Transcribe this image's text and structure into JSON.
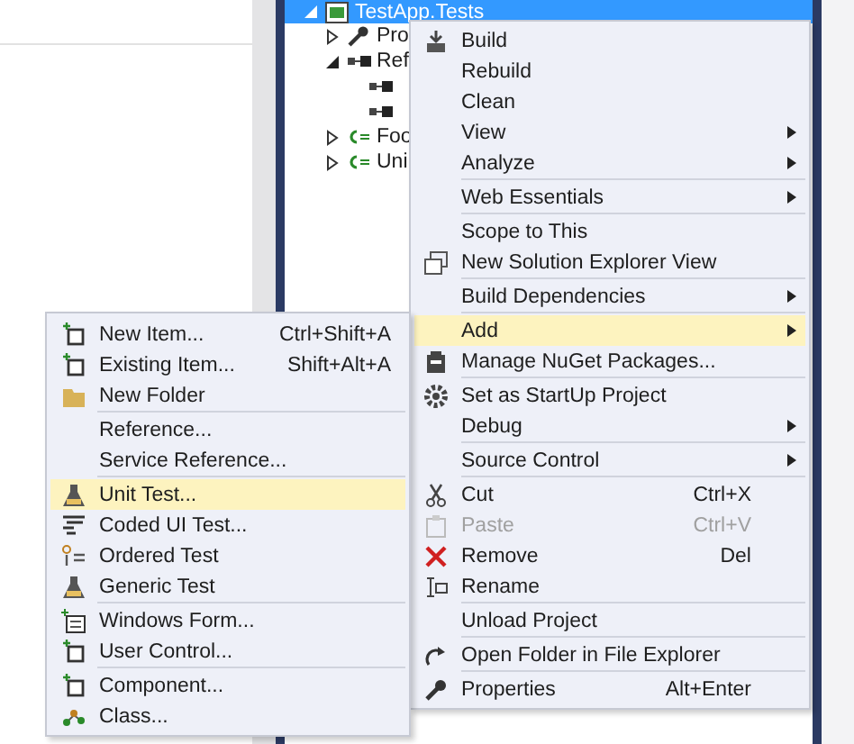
{
  "solution_explorer": {
    "tree": [
      {
        "label": "TestApp.Tests",
        "kind": "project",
        "expanded": true,
        "selected": true,
        "children": [
          {
            "label": "Pro",
            "kind": "properties",
            "expanded": false,
            "selected": false
          },
          {
            "label": "Ref",
            "kind": "references",
            "expanded": true,
            "selected": false,
            "children": [
              {
                "kind": "reference",
                "selected": false
              },
              {
                "kind": "reference",
                "selected": false
              }
            ]
          },
          {
            "label": "Foo",
            "kind": "csharp",
            "expanded": false,
            "selected": false
          },
          {
            "label": "Uni",
            "kind": "csharp",
            "expanded": false,
            "selected": false
          }
        ]
      }
    ]
  },
  "context_menu": {
    "items": [
      {
        "label": "Build",
        "submenu": false,
        "separator_before": false,
        "highlighted": false,
        "disabled": false
      },
      {
        "label": "Rebuild",
        "submenu": false,
        "separator_before": false,
        "highlighted": false,
        "disabled": false
      },
      {
        "label": "Clean",
        "submenu": false,
        "separator_before": false,
        "highlighted": false,
        "disabled": false
      },
      {
        "label": "View",
        "submenu": true,
        "separator_before": false,
        "highlighted": false,
        "disabled": false
      },
      {
        "label": "Analyze",
        "submenu": true,
        "separator_before": false,
        "highlighted": false,
        "disabled": false
      },
      {
        "label": "Web Essentials",
        "submenu": true,
        "separator_before": true,
        "highlighted": false,
        "disabled": false
      },
      {
        "label": "Scope to This",
        "submenu": false,
        "separator_before": true,
        "highlighted": false,
        "disabled": false
      },
      {
        "label": "New Solution Explorer View",
        "submenu": false,
        "separator_before": false,
        "highlighted": false,
        "disabled": false
      },
      {
        "label": "Build Dependencies",
        "submenu": true,
        "separator_before": true,
        "highlighted": false,
        "disabled": false
      },
      {
        "label": "Add",
        "submenu": true,
        "separator_before": true,
        "highlighted": true,
        "disabled": false
      },
      {
        "label": "Manage NuGet Packages...",
        "submenu": false,
        "separator_before": false,
        "highlighted": false,
        "disabled": false
      },
      {
        "label": "Set as StartUp Project",
        "submenu": false,
        "separator_before": true,
        "highlighted": false,
        "disabled": false
      },
      {
        "label": "Debug",
        "submenu": true,
        "separator_before": false,
        "highlighted": false,
        "disabled": false
      },
      {
        "label": "Source Control",
        "submenu": true,
        "separator_before": true,
        "highlighted": false,
        "disabled": false
      },
      {
        "label": "Cut",
        "shortcut": "Ctrl+X",
        "submenu": false,
        "separator_before": true,
        "highlighted": false,
        "disabled": false
      },
      {
        "label": "Paste",
        "shortcut": "Ctrl+V",
        "submenu": false,
        "separator_before": false,
        "highlighted": false,
        "disabled": true
      },
      {
        "label": "Remove",
        "shortcut": "Del",
        "submenu": false,
        "separator_before": false,
        "highlighted": false,
        "disabled": false
      },
      {
        "label": "Rename",
        "submenu": false,
        "separator_before": false,
        "highlighted": false,
        "disabled": false
      },
      {
        "label": "Unload Project",
        "submenu": false,
        "separator_before": true,
        "highlighted": false,
        "disabled": false
      },
      {
        "label": "Open Folder in File Explorer",
        "submenu": false,
        "separator_before": true,
        "highlighted": false,
        "disabled": false
      },
      {
        "label": "Properties",
        "shortcut": "Alt+Enter",
        "submenu": false,
        "separator_before": true,
        "highlighted": false,
        "disabled": false
      }
    ]
  },
  "add_submenu": {
    "items": [
      {
        "label": "New Item...",
        "shortcut": "Ctrl+Shift+A",
        "submenu": false,
        "separator_before": false,
        "highlighted": false,
        "disabled": false
      },
      {
        "label": "Existing Item...",
        "shortcut": "Shift+Alt+A",
        "submenu": false,
        "separator_before": false,
        "highlighted": false,
        "disabled": false
      },
      {
        "label": "New Folder",
        "submenu": false,
        "separator_before": false,
        "highlighted": false,
        "disabled": false
      },
      {
        "label": "Reference...",
        "submenu": false,
        "separator_before": true,
        "highlighted": false,
        "disabled": false
      },
      {
        "label": "Service Reference...",
        "submenu": false,
        "separator_before": false,
        "highlighted": false,
        "disabled": false
      },
      {
        "label": "Unit Test...",
        "submenu": false,
        "separator_before": true,
        "highlighted": true,
        "disabled": false
      },
      {
        "label": "Coded UI Test...",
        "submenu": false,
        "separator_before": false,
        "highlighted": false,
        "disabled": false
      },
      {
        "label": "Ordered Test",
        "submenu": false,
        "separator_before": false,
        "highlighted": false,
        "disabled": false
      },
      {
        "label": "Generic Test",
        "submenu": false,
        "separator_before": false,
        "highlighted": false,
        "disabled": false
      },
      {
        "label": "Windows Form...",
        "submenu": false,
        "separator_before": true,
        "highlighted": false,
        "disabled": false
      },
      {
        "label": "User Control...",
        "submenu": false,
        "separator_before": false,
        "highlighted": false,
        "disabled": false
      },
      {
        "label": "Component...",
        "submenu": false,
        "separator_before": true,
        "highlighted": false,
        "disabled": false
      },
      {
        "label": "Class...",
        "submenu": false,
        "separator_before": false,
        "highlighted": false,
        "disabled": false
      }
    ]
  }
}
